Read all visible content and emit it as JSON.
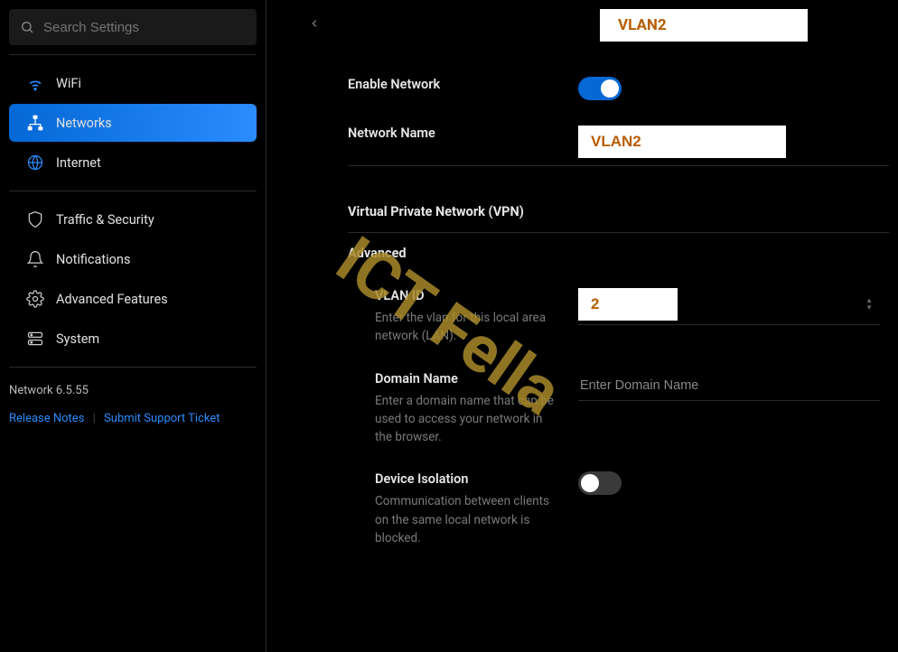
{
  "search": {
    "placeholder": "Search Settings"
  },
  "sidebar": {
    "items": [
      {
        "label": "WiFi"
      },
      {
        "label": "Networks"
      },
      {
        "label": "Internet"
      },
      {
        "label": "Traffic & Security"
      },
      {
        "label": "Notifications"
      },
      {
        "label": "Advanced Features"
      },
      {
        "label": "System"
      }
    ]
  },
  "version": "Network 6.5.55",
  "footer": {
    "release_notes": "Release Notes",
    "support": "Submit Support Ticket"
  },
  "page_title": "VLAN2",
  "form": {
    "enable_label": "Enable Network",
    "name_label": "Network Name",
    "name_value": "VLAN2",
    "vpn_section": "Virtual Private Network (VPN)",
    "advanced_section": "Advanced",
    "vlan_id_label": "VLAN ID",
    "vlan_id_help": "Enter the vlan for this local area network (LAN).",
    "vlan_id_value": "2",
    "domain_label": "Domain Name",
    "domain_help": "Enter a domain name that can be used to access your network in the browser.",
    "domain_placeholder": "Enter Domain Name",
    "isolation_label": "Device Isolation",
    "isolation_help": "Communication between clients on the same local network is blocked."
  },
  "watermark": "ICT Fella"
}
